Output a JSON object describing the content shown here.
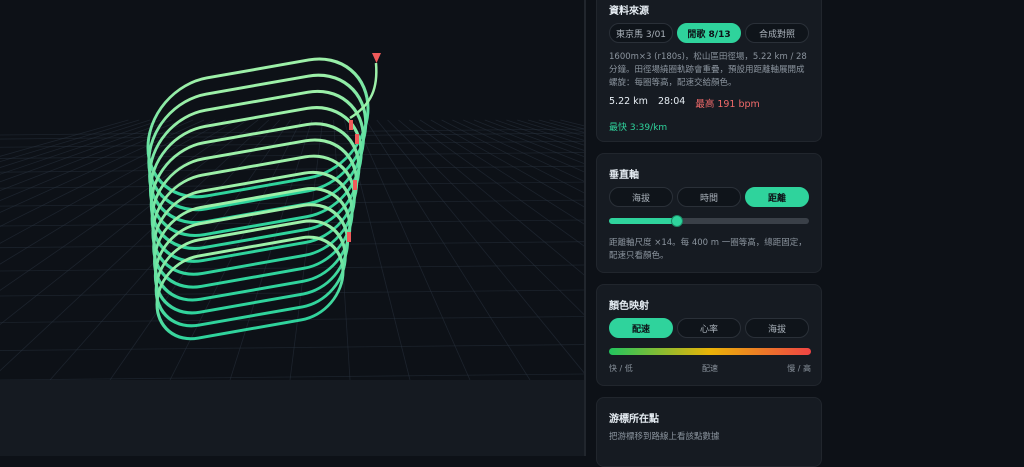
{
  "colors": {
    "accent": "#2fd39c",
    "heart_rate": "#f06a6a",
    "track_start": "#2fd39c",
    "track_end": "#9df0a8",
    "marker": "#f05a5a",
    "gradient_fast": "#22c55e",
    "gradient_mid": "#eab308",
    "gradient_slow": "#ef4444"
  },
  "viewport": {
    "track_icon": "spiral-track-icon",
    "marker_icon": "triangle-marker-icon"
  },
  "source": {
    "title": "資料來源",
    "options": [
      "東京馬 3/01",
      "閒歌 8/13",
      "合成對照"
    ],
    "active_index": 1,
    "description": "1600m×3 (r180s)，松山區田徑場，5.22 km / 28 分鐘。田徑場繞圈軌跡會重疊，預設用距離軸展開成螺旋：每圈等高，配速交給顏色。",
    "distance": "5.22 km",
    "duration": "28:04",
    "max_hr_label": "最高",
    "max_hr_value": "191 bpm",
    "fastest": "最快 3:39/km"
  },
  "vertical_axis": {
    "title": "垂直軸",
    "options": [
      "海拔",
      "時間",
      "距離"
    ],
    "active_index": 2,
    "scale_fraction": 0.34,
    "description": "距離軸尺度 ×14。每 400 m 一圈等高，總距固定，配速只看顏色。"
  },
  "color_mapping": {
    "title": "顏色映射",
    "options": [
      "配速",
      "心率",
      "海拔"
    ],
    "active_index": 0,
    "legend": [
      "快 / 低",
      "配速",
      "慢 / 高"
    ]
  },
  "cursor_point": {
    "title": "游標所在點",
    "hint": "把游標移到路線上看該點數據"
  }
}
